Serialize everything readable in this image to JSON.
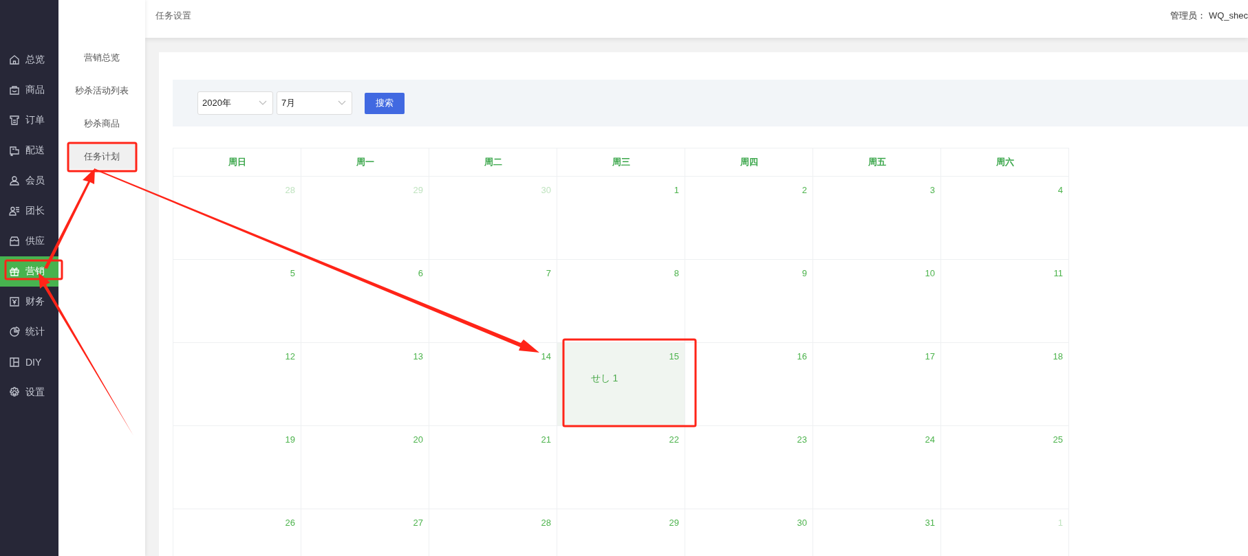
{
  "sidebar": {
    "items": [
      {
        "label": "总览",
        "selected": false
      },
      {
        "label": "商品",
        "selected": false
      },
      {
        "label": "订单",
        "selected": false
      },
      {
        "label": "配送",
        "selected": false
      },
      {
        "label": "会员",
        "selected": false
      },
      {
        "label": "团长",
        "selected": false
      },
      {
        "label": "供应",
        "selected": false
      },
      {
        "label": "营销",
        "selected": true
      },
      {
        "label": "财务",
        "selected": false
      },
      {
        "label": "统计",
        "selected": false
      },
      {
        "label": "DIY",
        "selected": false
      },
      {
        "label": "设置",
        "selected": false
      }
    ]
  },
  "submenu": {
    "items": [
      {
        "label": "营销总览",
        "selected": false
      },
      {
        "label": "秒杀活动列表",
        "selected": false
      },
      {
        "label": "秒杀商品",
        "selected": false
      },
      {
        "label": "任务计划",
        "selected": true
      }
    ]
  },
  "header": {
    "title": "任务设置",
    "admin": "管理员： WQ_shec"
  },
  "filter": {
    "year": "2020年",
    "month": "7月",
    "search_button": "搜索"
  },
  "calendar": {
    "weekdays": [
      "周日",
      "周一",
      "周二",
      "周三",
      "周四",
      "周五",
      "周六"
    ],
    "weeks": [
      [
        {
          "day": "28",
          "current_month": false,
          "highlighted": false
        },
        {
          "day": "29",
          "current_month": false,
          "highlighted": false
        },
        {
          "day": "30",
          "current_month": false,
          "highlighted": false
        },
        {
          "day": "1",
          "current_month": true,
          "highlighted": false
        },
        {
          "day": "2",
          "current_month": true,
          "highlighted": false
        },
        {
          "day": "3",
          "current_month": true,
          "highlighted": false
        },
        {
          "day": "4",
          "current_month": true,
          "highlighted": false
        }
      ],
      [
        {
          "day": "5",
          "current_month": true,
          "highlighted": false
        },
        {
          "day": "6",
          "current_month": true,
          "highlighted": false
        },
        {
          "day": "7",
          "current_month": true,
          "highlighted": false
        },
        {
          "day": "8",
          "current_month": true,
          "highlighted": false
        },
        {
          "day": "9",
          "current_month": true,
          "highlighted": false
        },
        {
          "day": "10",
          "current_month": true,
          "highlighted": false
        },
        {
          "day": "11",
          "current_month": true,
          "highlighted": false
        }
      ],
      [
        {
          "day": "12",
          "current_month": true,
          "highlighted": false
        },
        {
          "day": "13",
          "current_month": true,
          "highlighted": false
        },
        {
          "day": "14",
          "current_month": true,
          "highlighted": false
        },
        {
          "day": "15",
          "current_month": true,
          "highlighted": true,
          "events": [
            "せし 1"
          ]
        },
        {
          "day": "16",
          "current_month": true,
          "highlighted": false
        },
        {
          "day": "17",
          "current_month": true,
          "highlighted": false
        },
        {
          "day": "18",
          "current_month": true,
          "highlighted": false
        }
      ],
      [
        {
          "day": "19",
          "current_month": true,
          "highlighted": false
        },
        {
          "day": "20",
          "current_month": true,
          "highlighted": false
        },
        {
          "day": "21",
          "current_month": true,
          "highlighted": false
        },
        {
          "day": "22",
          "current_month": true,
          "highlighted": false
        },
        {
          "day": "23",
          "current_month": true,
          "highlighted": false
        },
        {
          "day": "24",
          "current_month": true,
          "highlighted": false
        },
        {
          "day": "25",
          "current_month": true,
          "highlighted": false
        }
      ],
      [
        {
          "day": "26",
          "current_month": true,
          "highlighted": false
        },
        {
          "day": "27",
          "current_month": true,
          "highlighted": false
        },
        {
          "day": "28",
          "current_month": true,
          "highlighted": false
        },
        {
          "day": "29",
          "current_month": true,
          "highlighted": false
        },
        {
          "day": "30",
          "current_month": true,
          "highlighted": false
        },
        {
          "day": "31",
          "current_month": true,
          "highlighted": false
        },
        {
          "day": "1",
          "current_month": false,
          "highlighted": false
        }
      ]
    ]
  }
}
